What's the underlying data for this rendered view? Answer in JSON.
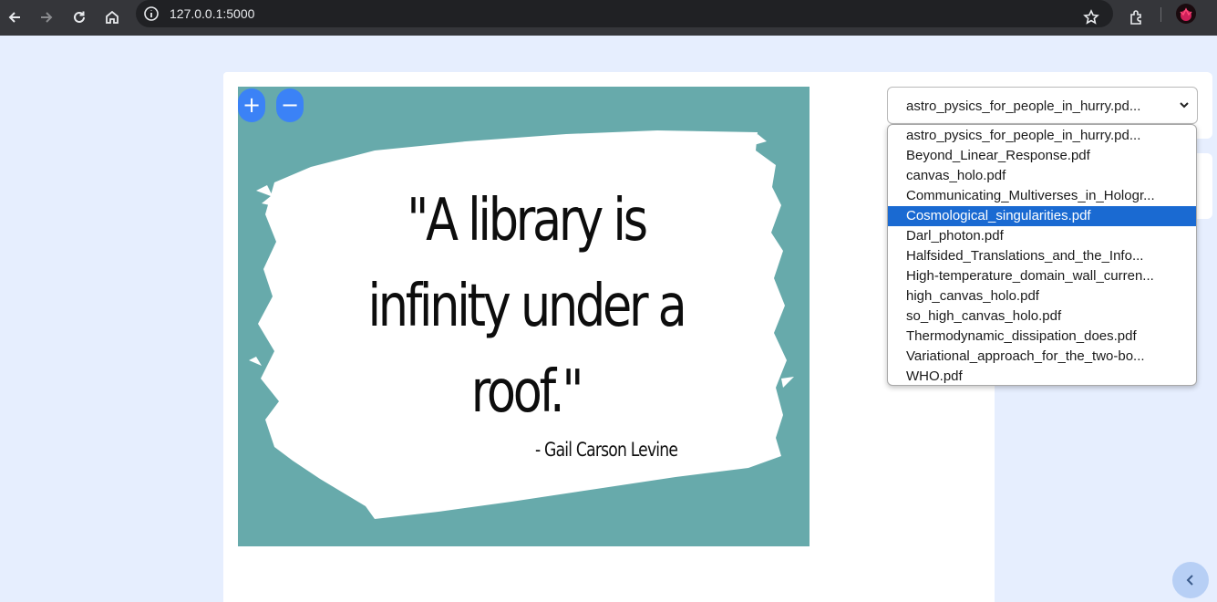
{
  "browser": {
    "url": "127.0.0.1:5000",
    "icons": [
      "back-arrow-icon",
      "forward-arrow-icon",
      "reload-icon",
      "home-icon",
      "site-info-icon",
      "bookmark-star-icon",
      "extensions-icon",
      "profile-avatar"
    ]
  },
  "viewer": {
    "quote": "\"A library is infinity under a roof.\"",
    "author": "- Gail Carson Levine",
    "background_color": "#67aaab",
    "zoom_in_label": "+",
    "zoom_out_label": "−"
  },
  "file_select": {
    "selected": "astro_pysics_for_people_in_hurry.pd...",
    "options": [
      "astro_pysics_for_people_in_hurry.pd...",
      "Beyond_Linear_Response.pdf",
      "canvas_holo.pdf",
      "Communicating_Multiverses_in_Hologr...",
      "Cosmological_singularities.pdf",
      "Darl_photon.pdf",
      "Halfsided_Translations_and_the_Info...",
      "High-temperature_domain_wall_curren...",
      "high_canvas_holo.pdf",
      "so_high_canvas_holo.pdf",
      "Thermodynamic_dissipation_does.pdf",
      "Variational_approach_for_the_two-bo...",
      "WHO.pdf"
    ],
    "highlighted": "Cosmological_singularities.pdf"
  },
  "colors": {
    "accent": "#3b82f6",
    "page_background": "#e6eefe",
    "highlight": "#1a6ad2"
  }
}
